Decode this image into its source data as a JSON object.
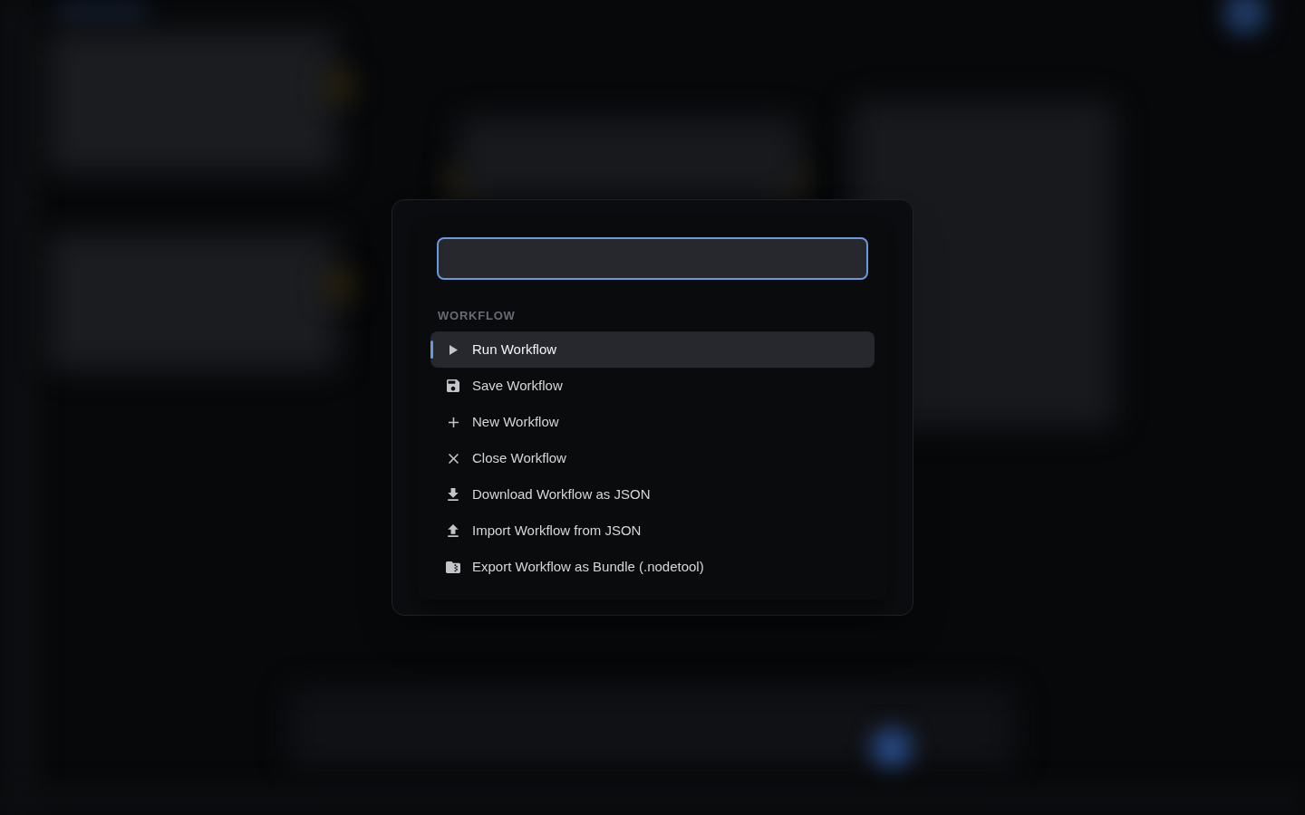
{
  "command_palette": {
    "search": {
      "focused": true
    },
    "sections": [
      {
        "heading": "WORKFLOW",
        "items": [
          {
            "kind": "run",
            "label": "Run Workflow",
            "selected": true
          },
          {
            "kind": "save",
            "label": "Save Workflow",
            "selected": false
          },
          {
            "kind": "new",
            "label": "New Workflow",
            "selected": false
          },
          {
            "kind": "close",
            "label": "Close Workflow",
            "selected": false
          },
          {
            "kind": "download",
            "label": "Download Workflow as JSON",
            "selected": false
          },
          {
            "kind": "import",
            "label": "Import Workflow from JSON",
            "selected": false
          },
          {
            "kind": "export",
            "label": "Export Workflow as Bundle (.nodetool)",
            "selected": false
          }
        ]
      }
    ]
  }
}
